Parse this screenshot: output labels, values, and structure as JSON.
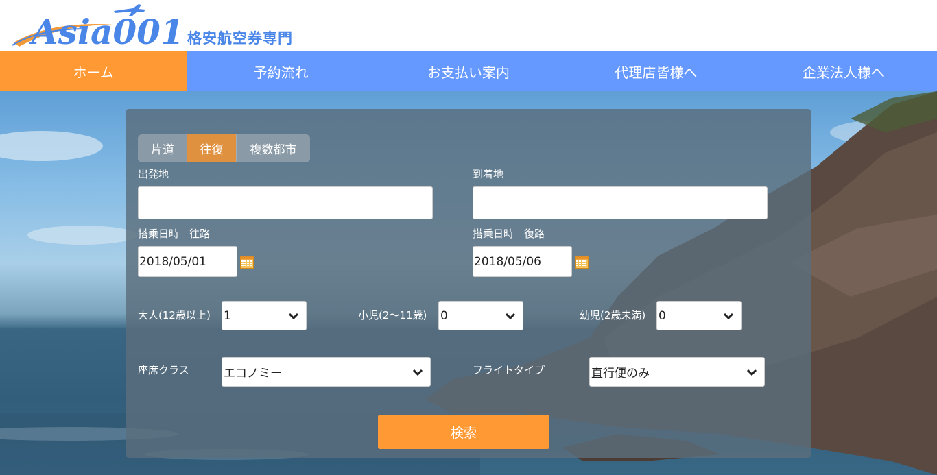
{
  "header": {
    "logo_text": "Asia001",
    "tagline": "格安航空券専門"
  },
  "nav": {
    "items": [
      {
        "label": "ホーム",
        "active": true
      },
      {
        "label": "予約流れ"
      },
      {
        "label": "お支払い案内"
      },
      {
        "label": "代理店皆様へ"
      },
      {
        "label": "企業法人様へ"
      }
    ]
  },
  "search": {
    "trip_types": [
      "片道",
      "往復",
      "複数都市"
    ],
    "selected_trip_type": "往復",
    "origin_label": "出発地",
    "origin_value": "",
    "destination_label": "到着地",
    "destination_value": "",
    "depart_label": "搭乗日時　往路",
    "depart_date": "2018/05/01",
    "return_label": "搭乗日時　復路",
    "return_date": "2018/05/06",
    "adult_label": "大人(12歳以上)",
    "adult_value": "1",
    "child_label": "小児(2～11歳)",
    "child_value": "0",
    "infant_label": "幼児(2歳未満)",
    "infant_value": "0",
    "class_label": "座席クラス",
    "class_value": "エコノミー",
    "flight_type_label": "フライトタイプ",
    "flight_type_value": "直行便のみ",
    "submit_label": "検索"
  },
  "icons": {
    "calendar": "calendar-icon",
    "chevron": "chevron-down-icon"
  },
  "colors": {
    "nav_blue": "#6699ff",
    "accent_orange": "#ff9933",
    "logo_blue": "#4a86e8"
  }
}
